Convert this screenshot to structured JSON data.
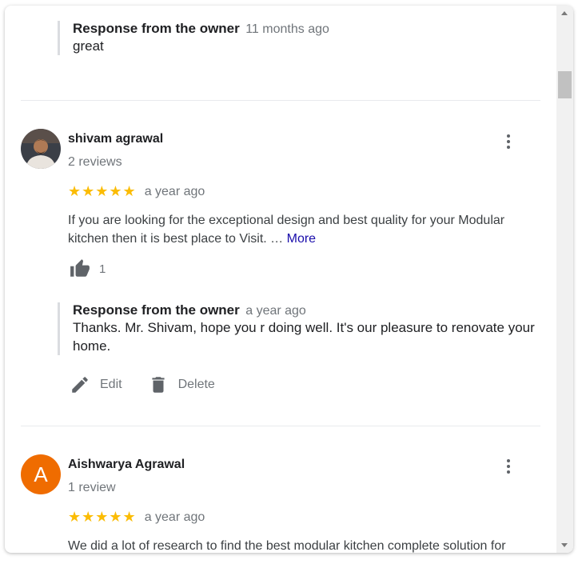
{
  "reviews": [
    {
      "owner_response": {
        "title": "Response from the owner",
        "time": "11 months ago",
        "text": "great"
      }
    },
    {
      "name": "shivam agrawal",
      "review_count": "2 reviews",
      "rating": 5,
      "stars": "★★★★★",
      "time": "a year ago",
      "text": "If you are looking for the exceptional design and best quality for your Modular kitchen then it is best place to Visit. …",
      "more_label": "More",
      "likes": "1",
      "owner_response": {
        "title": "Response from the owner",
        "time": "a year ago",
        "text": "Thanks. Mr. Shivam, hope you r doing well. It's our pleasure to renovate your home."
      },
      "edit_label": "Edit",
      "delete_label": "Delete"
    },
    {
      "name": "Aishwarya Agrawal",
      "avatar_letter": "A",
      "avatar_color": "#ef6c00",
      "review_count": "1 review",
      "rating": 5,
      "stars": "★★★★★",
      "time": "a year ago",
      "text": "We did a lot of research to find the best modular kitchen complete solution for"
    }
  ],
  "colors": {
    "star": "#fbbc04",
    "link": "#1a0dab",
    "secondary_text": "#70757a"
  }
}
